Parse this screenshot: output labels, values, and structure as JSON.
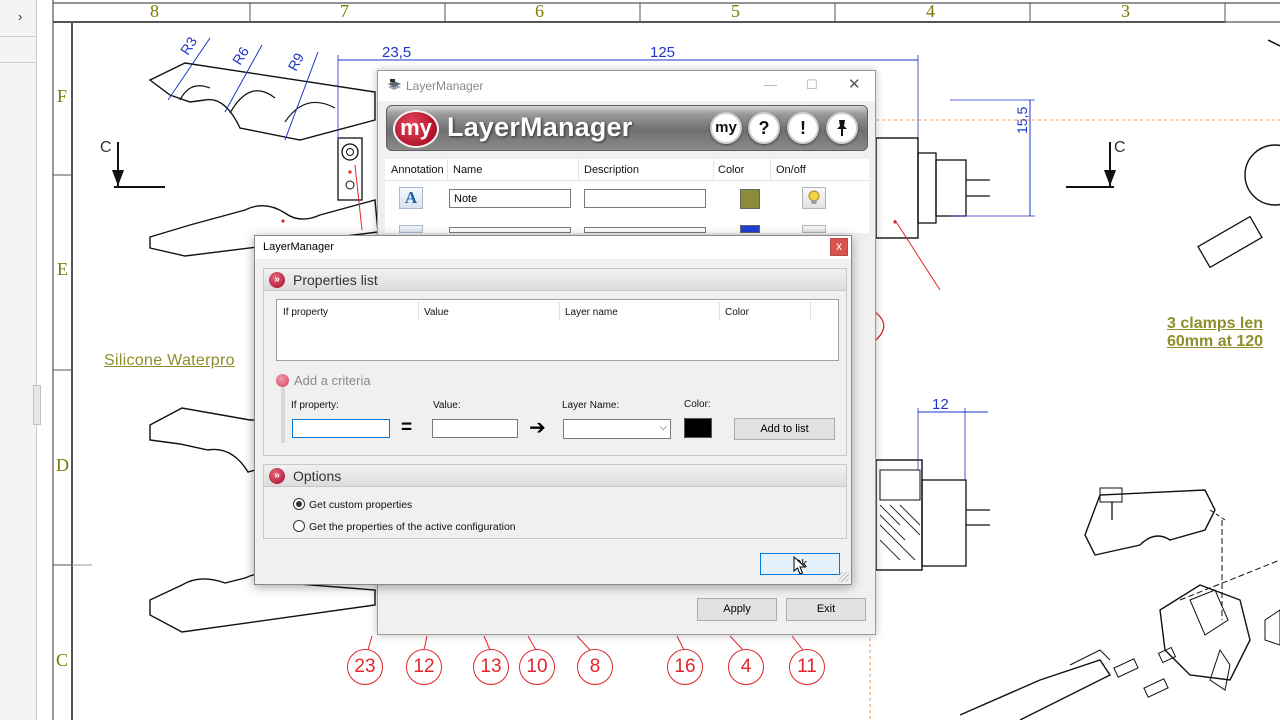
{
  "drawing": {
    "column_labels": [
      "8",
      "7",
      "6",
      "5",
      "4",
      "3"
    ],
    "row_labels": [
      "F",
      "E",
      "D",
      "C"
    ],
    "section_markers": [
      "C",
      "C"
    ],
    "dimensions": [
      "R3",
      "R6",
      "R9",
      "23,5",
      "125",
      "15,5",
      "12"
    ],
    "notes": {
      "silicone": "Silicone Waterpro",
      "clamps_line1": "3 clamps len",
      "clamps_line2": "60mm at 120"
    },
    "balloons": [
      "23",
      "12",
      "13",
      "10",
      "8",
      "16",
      "4",
      "11"
    ],
    "accent_color": "#e0262b",
    "note_color": "#8e8e2c"
  },
  "back_window": {
    "title": "LayerManager",
    "banner_logo": "my",
    "banner_title": "LayerManager",
    "banner_buttons": [
      "my",
      "?",
      "!",
      "pin-icon"
    ],
    "columns": [
      "Annotation",
      "Name",
      "Description",
      "Color",
      "On/off"
    ],
    "rows": [
      {
        "annotation": "A",
        "name": "Note",
        "description": "",
        "color": "#8b8b3a"
      },
      {
        "annotation": "A",
        "name": "",
        "description": "",
        "color": "#1f3fd9"
      }
    ],
    "apply_label": "Apply",
    "exit_label": "Exit"
  },
  "dialog": {
    "title": "LayerManager",
    "close_label": "x",
    "properties_title": "Properties list",
    "properties_columns": [
      "If property",
      "Value",
      "Layer name",
      "Color"
    ],
    "criteria_title": "Add a criteria",
    "if_property_label": "If property:",
    "value_label": "Value:",
    "layer_name_label": "Layer Name:",
    "color_label": "Color:",
    "equals": "=",
    "arrow": "➔",
    "if_property_value": "",
    "value_value": "",
    "layer_name_value": "",
    "criteria_color": "#000000",
    "add_to_list_label": "Add to list",
    "options_title": "Options",
    "options": [
      {
        "label": "Get custom properties",
        "selected": true
      },
      {
        "label": "Get the properties of the active configuration",
        "selected": false
      }
    ],
    "ok_label": "Ok"
  }
}
